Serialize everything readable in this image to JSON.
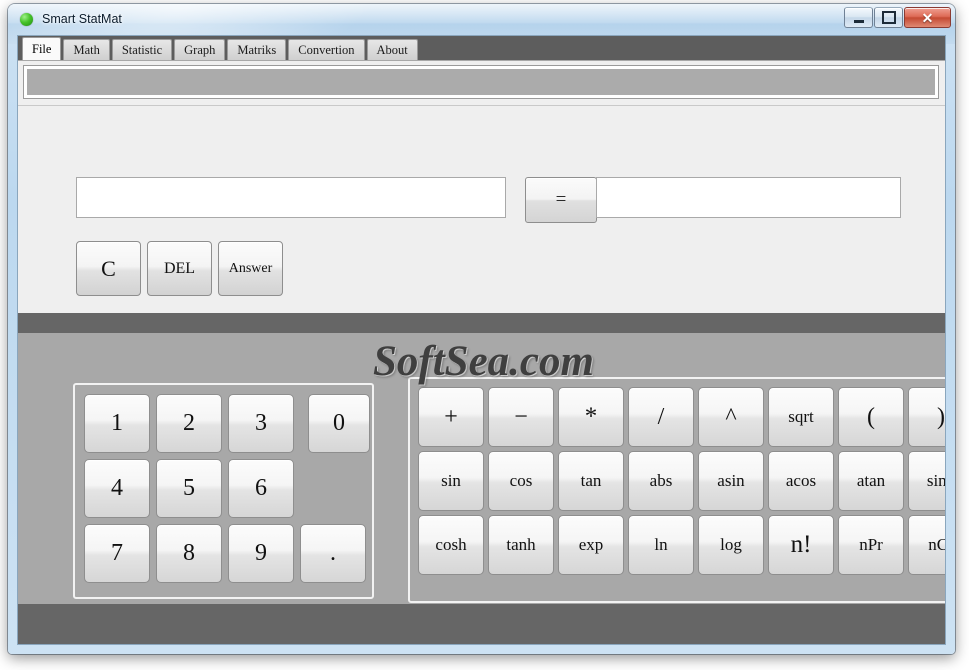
{
  "window": {
    "title": "Smart StatMat",
    "app_icon": "green-circle-icon",
    "caption": {
      "minimize_label": "–",
      "maximize_label": "□",
      "close_label": "✕"
    }
  },
  "tabs": [
    {
      "label": "File",
      "active": true
    },
    {
      "label": "Math",
      "active": false
    },
    {
      "label": "Statistic",
      "active": false
    },
    {
      "label": "Graph",
      "active": false
    },
    {
      "label": "Matriks",
      "active": false
    },
    {
      "label": "Convertion",
      "active": false
    },
    {
      "label": "About",
      "active": false
    }
  ],
  "calculator": {
    "expression_value": "",
    "expression_placeholder": "",
    "result_value": "",
    "result_placeholder": "",
    "equals_label": "=",
    "controls": [
      {
        "label": "C",
        "name": "clear-button",
        "style": "c-key"
      },
      {
        "label": "DEL",
        "name": "delete-button",
        "style": "del-key"
      },
      {
        "label": "Answer",
        "name": "answer-button",
        "style": "ans-key"
      }
    ]
  },
  "numpad": [
    {
      "label": "1",
      "kind": "num"
    },
    {
      "label": "2",
      "kind": "num"
    },
    {
      "label": "3",
      "kind": "num"
    },
    {
      "label": "0",
      "kind": "num narrow-zero"
    },
    {
      "label": "4",
      "kind": "num"
    },
    {
      "label": "5",
      "kind": "num"
    },
    {
      "label": "6",
      "kind": "num"
    },
    {
      "label": "",
      "kind": "blank"
    },
    {
      "label": "7",
      "kind": "num"
    },
    {
      "label": "8",
      "kind": "num"
    },
    {
      "label": "9",
      "kind": "num"
    },
    {
      "label": ".",
      "kind": "num"
    }
  ],
  "funcpad": [
    {
      "label": "+",
      "kind": "fn-sym"
    },
    {
      "label": "−",
      "kind": "fn-sym"
    },
    {
      "label": "*",
      "kind": "fn-big"
    },
    {
      "label": "/",
      "kind": "fn-sym"
    },
    {
      "label": "^",
      "kind": "fn-sym"
    },
    {
      "label": "sqrt",
      "kind": "fn-word"
    },
    {
      "label": "(",
      "kind": "fn-sym"
    },
    {
      "label": ")",
      "kind": "fn-sym"
    },
    {
      "label": "sin",
      "kind": "fn-word"
    },
    {
      "label": "cos",
      "kind": "fn-word"
    },
    {
      "label": "tan",
      "kind": "fn-word"
    },
    {
      "label": "abs",
      "kind": "fn-word"
    },
    {
      "label": "asin",
      "kind": "fn-word"
    },
    {
      "label": "acos",
      "kind": "fn-word"
    },
    {
      "label": "atan",
      "kind": "fn-word"
    },
    {
      "label": "sinh",
      "kind": "fn-word"
    },
    {
      "label": "cosh",
      "kind": "fn-word"
    },
    {
      "label": "tanh",
      "kind": "fn-word"
    },
    {
      "label": "exp",
      "kind": "fn-word"
    },
    {
      "label": "ln",
      "kind": "fn-word"
    },
    {
      "label": "log",
      "kind": "fn-word"
    },
    {
      "label": "n!",
      "kind": "fn-big"
    },
    {
      "label": "nPr",
      "kind": "fn-word"
    },
    {
      "label": "nCr",
      "kind": "fn-word"
    }
  ],
  "watermark": {
    "text": "SoftSea.com"
  },
  "colors": {
    "titlebar_glass": "#b9d6ee",
    "client_background": "#efefef",
    "tabstrip": "#5d5d5d",
    "top_panel": "#ababab",
    "dark_band": "#666666",
    "keypad_stage": "#a8a8a8",
    "close_button": "#c44a33"
  }
}
